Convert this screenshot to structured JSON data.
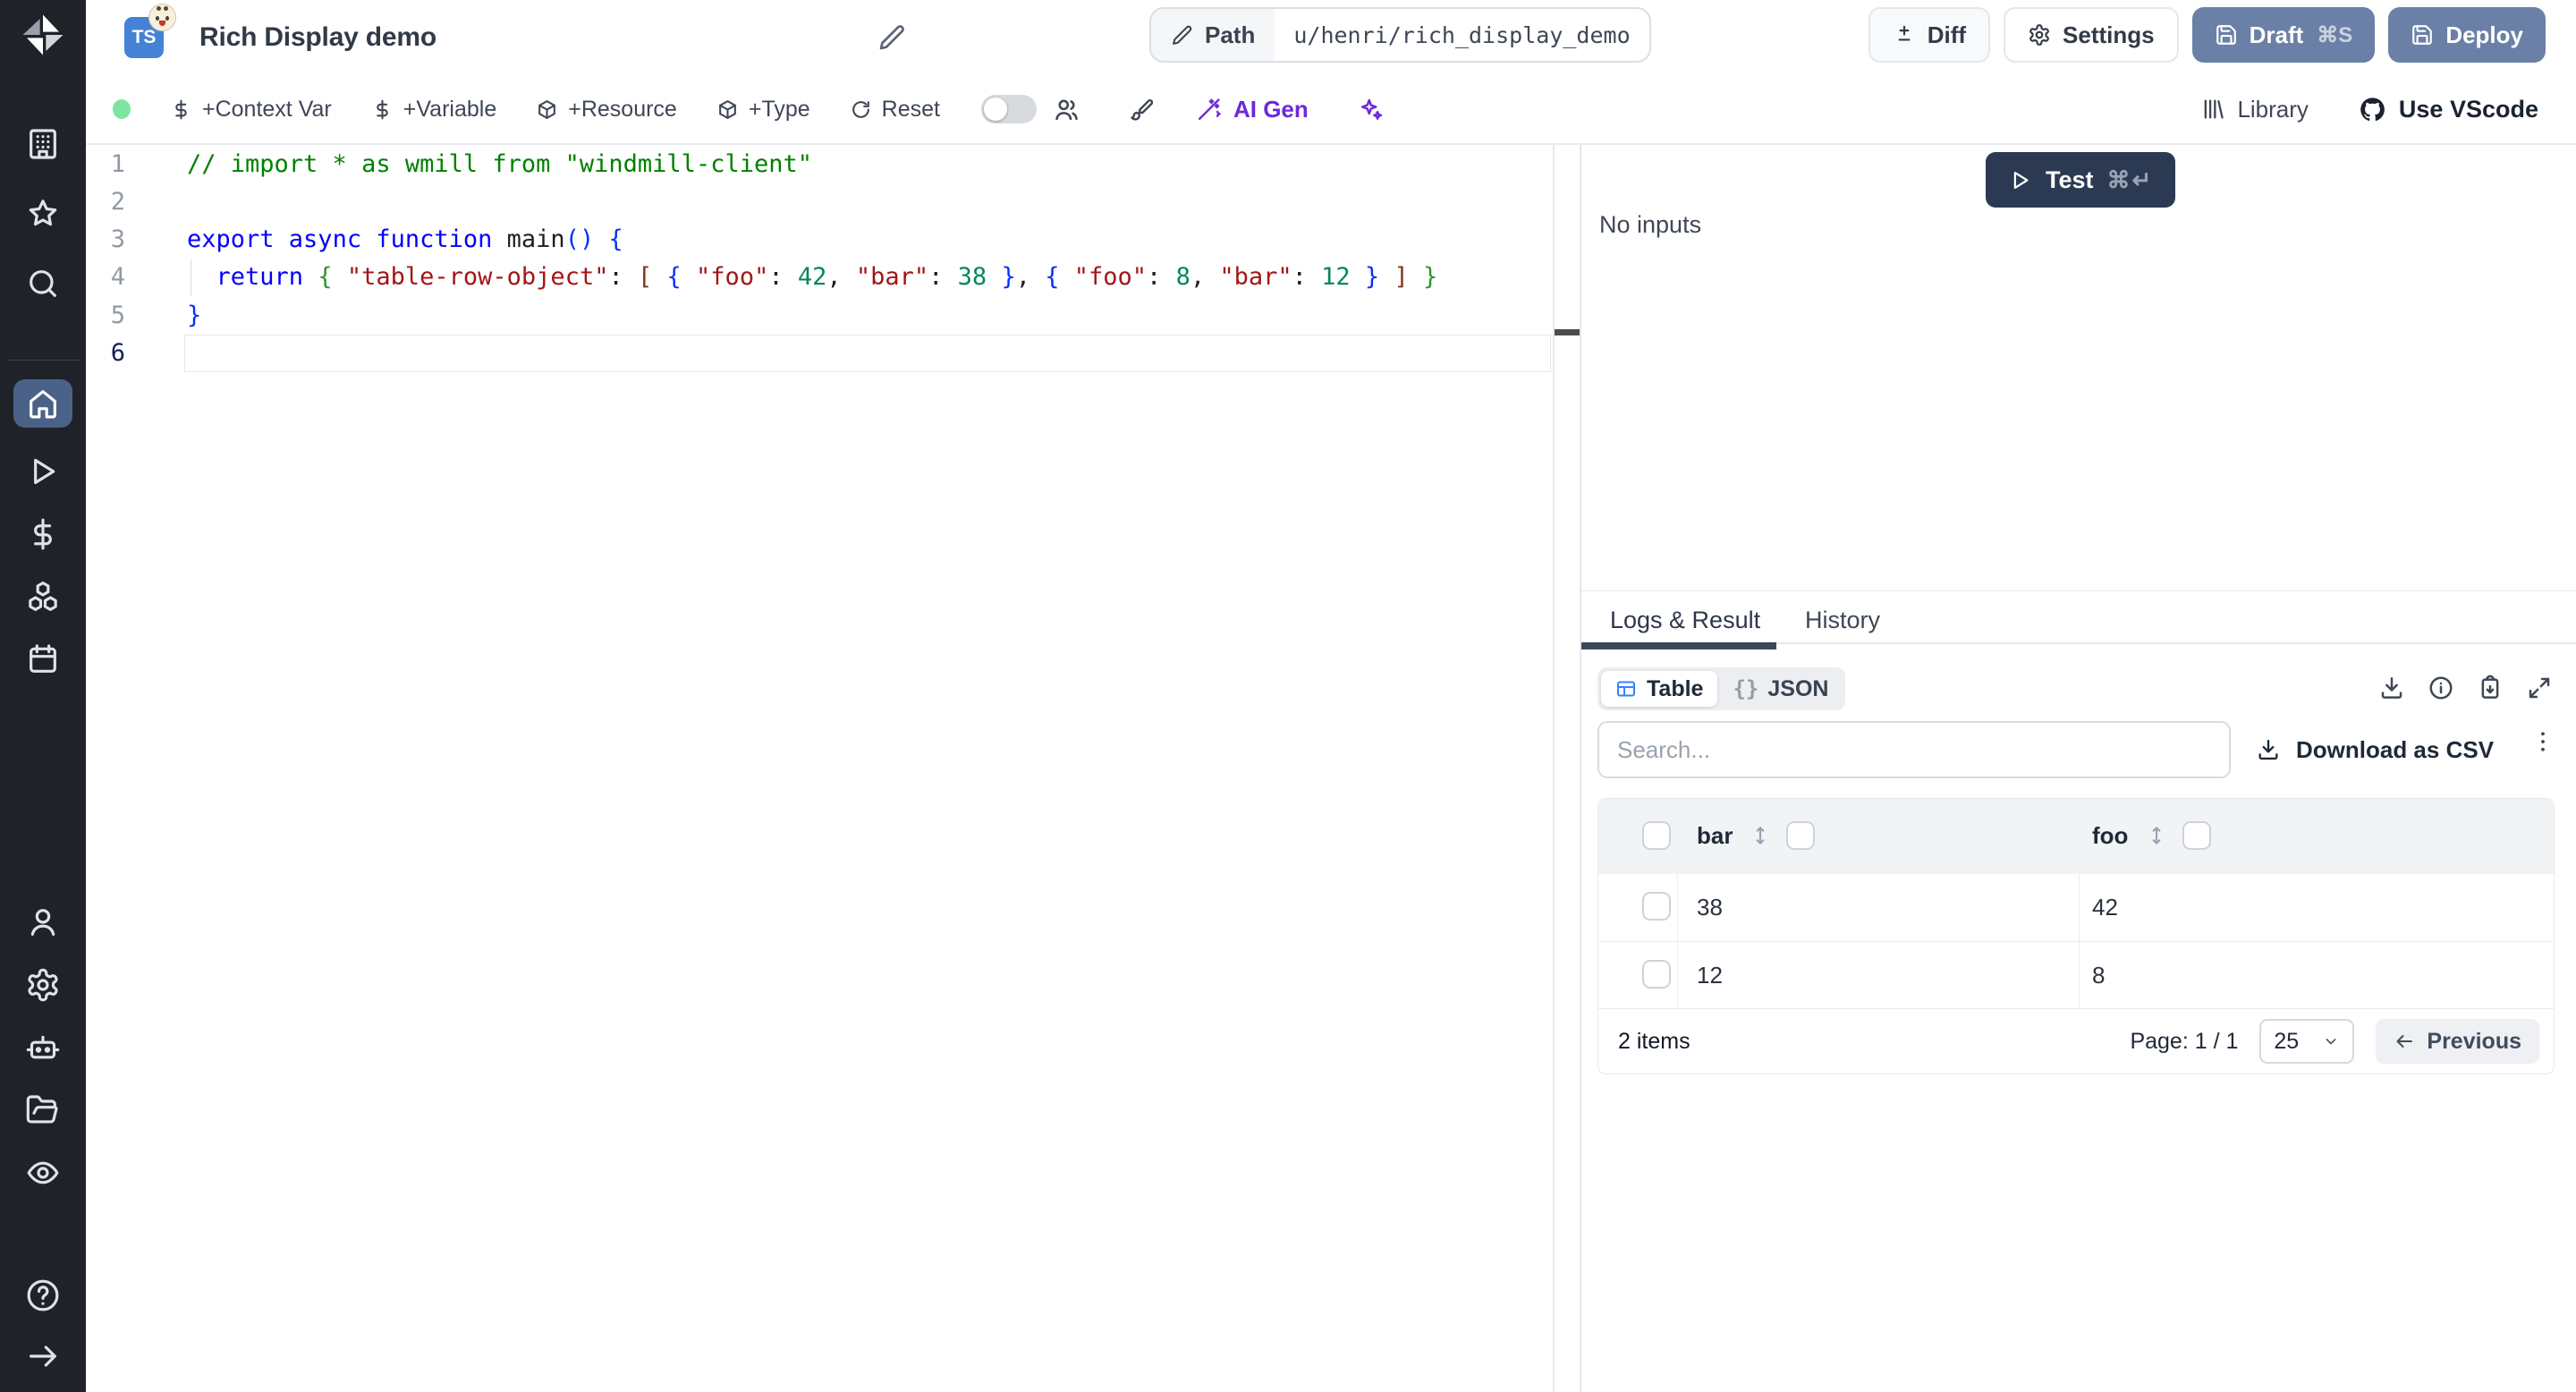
{
  "colors": {
    "accent_slate": "#6b80a6",
    "dark_navy": "#2b3a52",
    "sidebar_bg": "#1f2329",
    "sidebar_active": "#4b6288",
    "ai_purple": "#6d28d9",
    "status_green": "#7fe3a4",
    "table_icon_blue": "#3b82f6",
    "ts_badge_blue": "#4582d6"
  },
  "sidebar": {
    "top": [
      {
        "icon": "building"
      },
      {
        "icon": "star"
      },
      {
        "icon": "search"
      }
    ],
    "main": [
      {
        "icon": "home",
        "active": true
      },
      {
        "icon": "play"
      },
      {
        "icon": "dollar-sign"
      },
      {
        "icon": "cubes"
      },
      {
        "icon": "calendar"
      }
    ],
    "bottom": [
      {
        "icon": "user"
      },
      {
        "icon": "gear"
      },
      {
        "icon": "robot"
      },
      {
        "icon": "folder-open"
      },
      {
        "icon": "eye"
      }
    ],
    "footer": [
      {
        "icon": "help"
      },
      {
        "icon": "arrow-right"
      }
    ]
  },
  "header": {
    "language_badge": "TS",
    "title": "Rich Display demo",
    "path_label": "Path",
    "path_value": "u/henri/rich_display_demo",
    "diff_label": "Diff",
    "settings_label": "Settings",
    "draft_label": "Draft",
    "draft_shortcut": "⌘S",
    "deploy_label": "Deploy"
  },
  "toolbar": {
    "items": [
      {
        "icon": "dollar-sign",
        "label": "+Context Var"
      },
      {
        "icon": "dollar-sign",
        "label": "+Variable"
      },
      {
        "icon": "package",
        "label": "+Resource"
      },
      {
        "icon": "package",
        "label": "+Type"
      },
      {
        "icon": "refresh",
        "label": "Reset"
      }
    ],
    "ai_gen_label": "AI Gen",
    "right": {
      "library_label": "Library",
      "vscode_label": "Use VScode"
    }
  },
  "editor": {
    "lines": [
      {
        "num": "1",
        "tokens": [
          {
            "t": "// import * as wmill from \"windmill-client\"",
            "c": "comment"
          }
        ]
      },
      {
        "num": "2",
        "tokens": []
      },
      {
        "num": "3",
        "tokens": [
          {
            "t": "export ",
            "c": "kw"
          },
          {
            "t": "async ",
            "c": "kw"
          },
          {
            "t": "function ",
            "c": "kw"
          },
          {
            "t": "main",
            "c": "fn"
          },
          {
            "t": "()",
            "c": "b1"
          },
          {
            "t": " ",
            "c": "plain"
          },
          {
            "t": "{",
            "c": "b1"
          }
        ]
      },
      {
        "num": "4",
        "tokens": [
          {
            "t": "  ",
            "c": "plain"
          },
          {
            "t": "return",
            "c": "kw"
          },
          {
            "t": " ",
            "c": "plain"
          },
          {
            "t": "{",
            "c": "b2"
          },
          {
            "t": " ",
            "c": "plain"
          },
          {
            "t": "\"table-row-object\"",
            "c": "str"
          },
          {
            "t": ": ",
            "c": "plain"
          },
          {
            "t": "[",
            "c": "b3"
          },
          {
            "t": " ",
            "c": "plain"
          },
          {
            "t": "{",
            "c": "b1"
          },
          {
            "t": " ",
            "c": "plain"
          },
          {
            "t": "\"foo\"",
            "c": "str"
          },
          {
            "t": ": ",
            "c": "plain"
          },
          {
            "t": "42",
            "c": "num"
          },
          {
            "t": ", ",
            "c": "plain"
          },
          {
            "t": "\"bar\"",
            "c": "str"
          },
          {
            "t": ": ",
            "c": "plain"
          },
          {
            "t": "38",
            "c": "num"
          },
          {
            "t": " ",
            "c": "plain"
          },
          {
            "t": "}",
            "c": "b1"
          },
          {
            "t": ", ",
            "c": "plain"
          },
          {
            "t": "{",
            "c": "b1"
          },
          {
            "t": " ",
            "c": "plain"
          },
          {
            "t": "\"foo\"",
            "c": "str"
          },
          {
            "t": ": ",
            "c": "plain"
          },
          {
            "t": "8",
            "c": "num"
          },
          {
            "t": ", ",
            "c": "plain"
          },
          {
            "t": "\"bar\"",
            "c": "str"
          },
          {
            "t": ": ",
            "c": "plain"
          },
          {
            "t": "12",
            "c": "num"
          },
          {
            "t": " ",
            "c": "plain"
          },
          {
            "t": "}",
            "c": "b1"
          },
          {
            "t": " ",
            "c": "plain"
          },
          {
            "t": "]",
            "c": "b3"
          },
          {
            "t": " ",
            "c": "plain"
          },
          {
            "t": "}",
            "c": "b2"
          }
        ]
      },
      {
        "num": "5",
        "tokens": [
          {
            "t": "}",
            "c": "b1"
          }
        ]
      },
      {
        "num": "6",
        "tokens": [],
        "active": true
      }
    ]
  },
  "run": {
    "test_label": "Test",
    "test_shortcut": "⌘↵",
    "no_inputs_label": "No inputs"
  },
  "results": {
    "tabs": [
      {
        "label": "Logs & Result",
        "active": true
      },
      {
        "label": "History",
        "active": false
      }
    ],
    "toggle": {
      "table_label": "Table",
      "json_glyph": "{}",
      "json_label": "JSON"
    },
    "search_placeholder": "Search...",
    "download_csv_label": "Download as CSV",
    "table": {
      "columns": [
        {
          "label": "bar"
        },
        {
          "label": "foo"
        }
      ],
      "rows": [
        [
          "38",
          "42"
        ],
        [
          "12",
          "8"
        ]
      ],
      "footer": {
        "items_label": "2 items",
        "page_label": "Page: 1 / 1",
        "page_size": "25",
        "previous_label": "Previous"
      }
    }
  }
}
